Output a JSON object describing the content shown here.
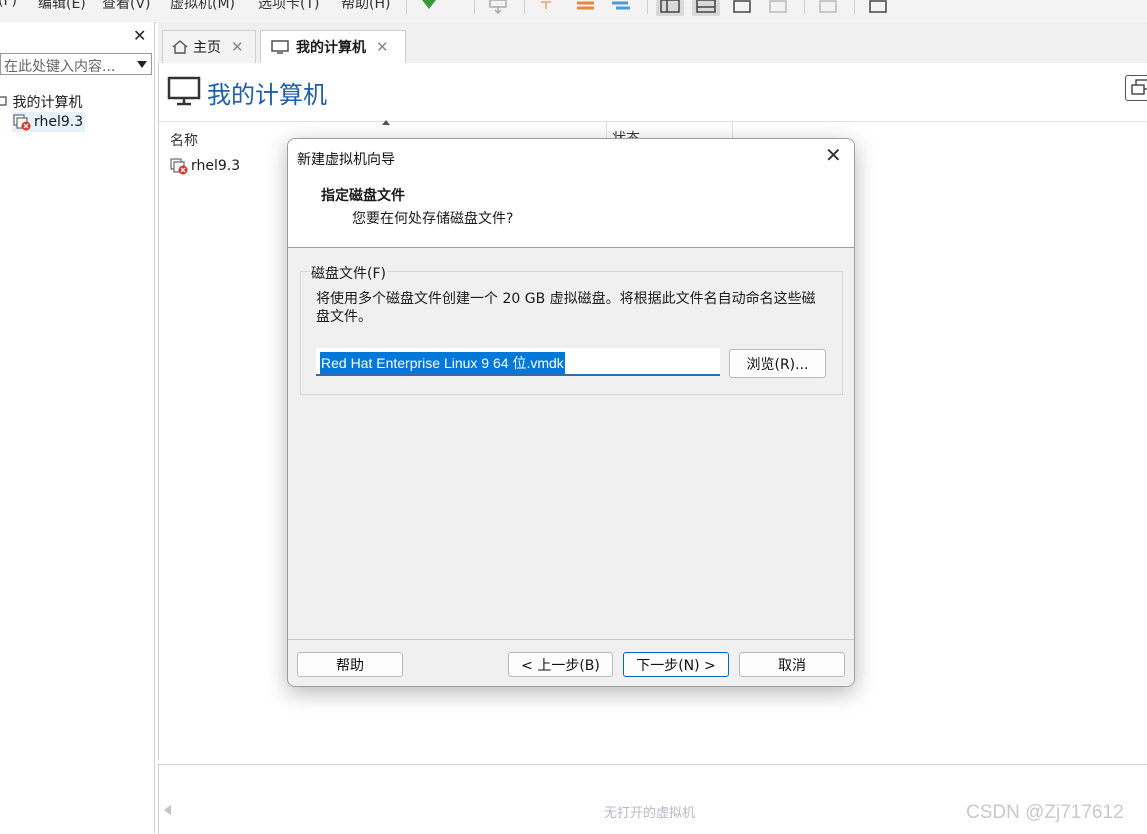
{
  "menubar": {
    "items": [
      "(F)",
      "编辑(E)",
      "查看(V)",
      "虚拟机(M)",
      "选项卡(T)",
      "帮助(H)"
    ]
  },
  "library": {
    "search_placeholder": "在此处键入内容...",
    "root_label": "我的计算机",
    "vm_label": "rhel9.3"
  },
  "tabs": [
    {
      "label": "主页"
    },
    {
      "label": "我的计算机"
    }
  ],
  "content": {
    "title": "我的计算机",
    "columns": [
      "名称",
      "状态"
    ],
    "rows": [
      {
        "name": "rhel9.3"
      }
    ]
  },
  "thumbnail_bar": {
    "message": "无打开的虚拟机"
  },
  "dialog": {
    "title": "新建虚拟机向导",
    "heading": "指定磁盘文件",
    "subheading": "您要在何处存储磁盘文件?",
    "group_label": "磁盘文件(F)",
    "description": "将使用多个磁盘文件创建一个 20 GB 虚拟磁盘。将根据此文件名自动命名这些磁盘文件。",
    "file_value": "Red Hat Enterprise Linux 9 64 位.vmdk",
    "browse_label": "浏览(R)...",
    "help_label": "帮助",
    "back_label": "< 上一步(B)",
    "next_label": "下一步(N) >",
    "cancel_label": "取消"
  },
  "watermark": "CSDN @Zj717612",
  "colors": {
    "accent": "#1f5fa8",
    "selection": "#0078d7",
    "play_green": "#3a9a3a"
  }
}
